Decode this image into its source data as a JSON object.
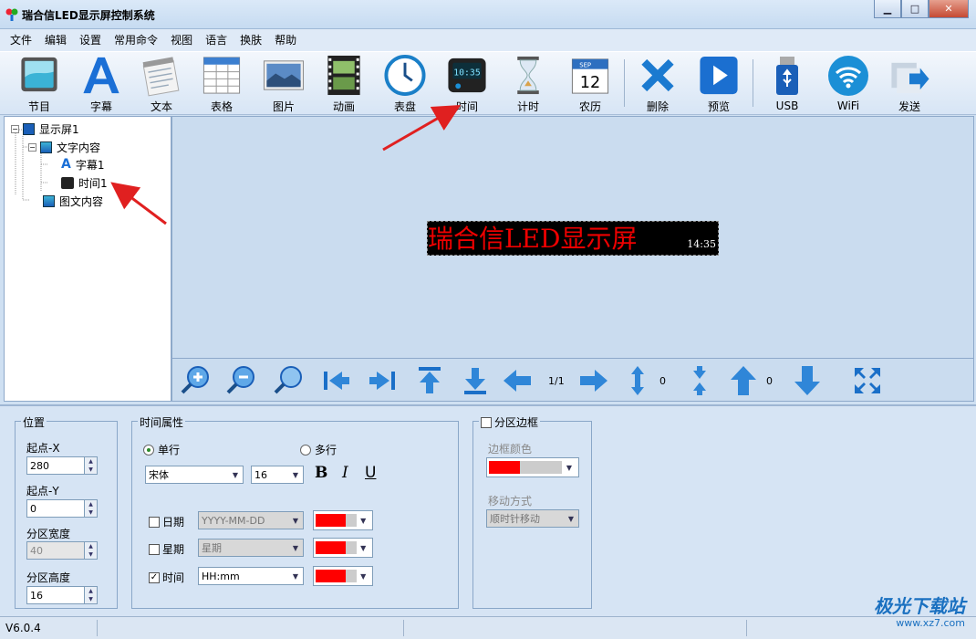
{
  "window": {
    "title": "瑞合信LED显示屏控制系统",
    "min": "▁",
    "max": "□",
    "close": "✕"
  },
  "menu": [
    "文件",
    "编辑",
    "设置",
    "常用命令",
    "视图",
    "语言",
    "换肤",
    "帮助"
  ],
  "toolbar": [
    {
      "label": "节目",
      "icon": "program-icon"
    },
    {
      "label": "字幕",
      "icon": "subtitle-icon"
    },
    {
      "label": "文本",
      "icon": "text-icon"
    },
    {
      "label": "表格",
      "icon": "table-icon"
    },
    {
      "label": "图片",
      "icon": "picture-icon"
    },
    {
      "label": "动画",
      "icon": "animation-icon"
    },
    {
      "label": "表盘",
      "icon": "dial-icon"
    },
    {
      "label": "时间",
      "icon": "clock-icon"
    },
    {
      "label": "计时",
      "icon": "hourglass-icon"
    },
    {
      "label": "农历",
      "icon": "calendar-icon"
    },
    {
      "label": "删除",
      "icon": "delete-icon"
    },
    {
      "label": "预览",
      "icon": "preview-icon"
    },
    {
      "label": "USB",
      "icon": "usb-icon"
    },
    {
      "label": "WiFi",
      "icon": "wifi-icon"
    },
    {
      "label": "发送",
      "icon": "send-icon"
    }
  ],
  "toolbar_icon_text": {
    "clock_face": "10:35",
    "calendar_month": "SEP",
    "calendar_day": "12"
  },
  "tree": {
    "screen": "显示屏1",
    "text_area": "文字内容",
    "subtitle": "字幕1",
    "time": "时间1",
    "image_text": "图文内容"
  },
  "preview": {
    "led_text": "瑞合信LED显示屏",
    "clock_overlay": "14:35"
  },
  "nav": {
    "page": "1/1",
    "vcount": "0",
    "vcount2": "0"
  },
  "position": {
    "title": "位置",
    "x_label": "起点-X",
    "x_value": "280",
    "y_label": "起点-Y",
    "y_value": "0",
    "w_label": "分区宽度",
    "w_value": "40",
    "h_label": "分区高度",
    "h_value": "16"
  },
  "time_props": {
    "title": "时间属性",
    "single": "单行",
    "multi": "多行",
    "font": "宋体",
    "size": "16",
    "bold": "B",
    "italic": "I",
    "underline": "U",
    "date_label": "日期",
    "date_format": "YYYY-MM-DD",
    "date_checked": false,
    "week_label": "星期",
    "week_format": "星期",
    "week_checked": false,
    "time_label": "时间",
    "time_format": "HH:mm",
    "time_checked": true,
    "color_red": "#ff0000"
  },
  "border": {
    "title": "分区边框",
    "color_label": "边框颜色",
    "move_label": "移动方式",
    "move_value": "顺时针移动"
  },
  "status": {
    "version": "V6.0.4"
  },
  "watermark": {
    "brand": "极光下载站",
    "url": "www.xz7.com"
  }
}
